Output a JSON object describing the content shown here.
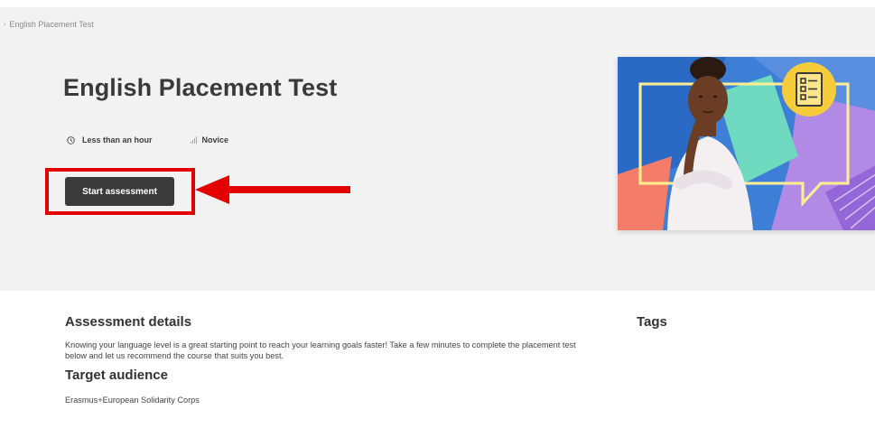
{
  "breadcrumb": {
    "separator": "›",
    "current": "English Placement Test"
  },
  "hero": {
    "title": "English Placement Test",
    "duration": "Less than an hour",
    "level": "Novice",
    "start_button_label": "Start assessment"
  },
  "details": {
    "heading": "Assessment details",
    "description": "Knowing your language level is a great starting point to reach your learning goals faster! Take a few minutes to complete the placement test below and let us recommend the course that suits you best.",
    "audience_heading": "Target audience",
    "audience": "Erasmus+European Solidarity Corps"
  },
  "tags": {
    "heading": "Tags"
  },
  "colors": {
    "hero_bg": "#f2f2f2",
    "button_bg": "#3a3a3a",
    "annotation_red": "#e30000"
  },
  "icons": {
    "duration": "clock-icon",
    "level": "signal-bars-icon"
  }
}
